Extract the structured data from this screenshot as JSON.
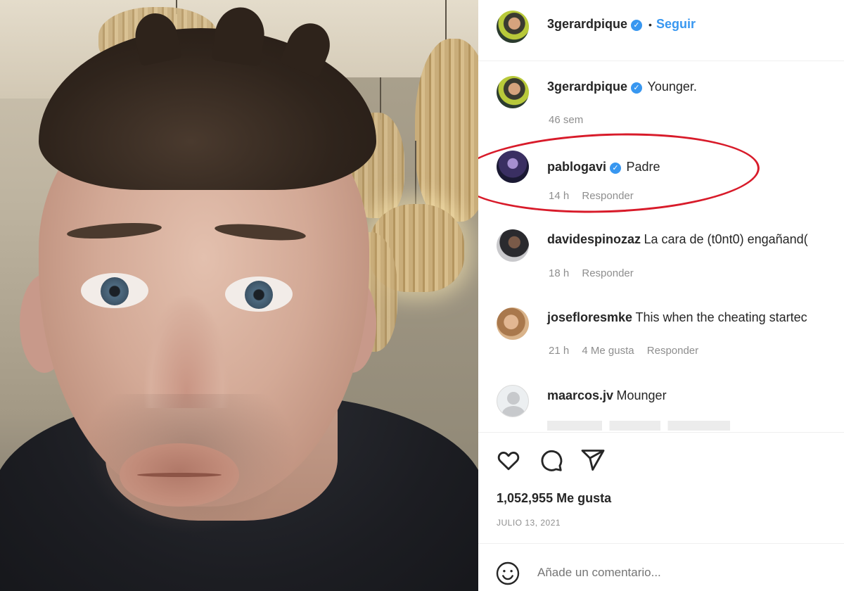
{
  "header": {
    "username": "3gerardpique",
    "follow_label": "Seguir"
  },
  "comments": [
    {
      "username": "3gerardpique",
      "verified": true,
      "text": "Younger.",
      "time": "46 sem",
      "likes": "",
      "reply": ""
    },
    {
      "username": "pablogavi",
      "verified": true,
      "text": "Padre",
      "time": "14 h",
      "likes": "",
      "reply": "Responder"
    },
    {
      "username": "davidespinozaz",
      "verified": false,
      "text": "La cara de (t0nt0) engañand(",
      "time": "18 h",
      "likes": "",
      "reply": "Responder"
    },
    {
      "username": "josefloresmke",
      "verified": false,
      "text": "This when the cheating startec",
      "time": "21 h",
      "likes": "4 Me gusta",
      "reply": "Responder"
    },
    {
      "username": "maarcos.jv",
      "verified": false,
      "text": "Mounger",
      "time": "",
      "likes": "",
      "reply": ""
    }
  ],
  "actions": {
    "like_icon": "heart-icon",
    "comment_icon": "comment-icon",
    "share_icon": "send-icon"
  },
  "post": {
    "likes": "1,052,955 Me gusta",
    "date": "JULIO 13, 2021"
  },
  "comment_box": {
    "placeholder": "Añade un comentario..."
  },
  "colors": {
    "accent": "#3897f0",
    "highlight": "#d81b2a",
    "muted": "#8e8e8e"
  }
}
